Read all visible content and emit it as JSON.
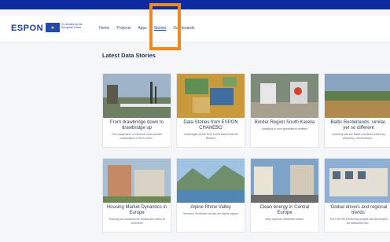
{
  "header": {
    "logo_text": "ESPON",
    "eu_text": "Co-funded by the European Union",
    "nav": [
      {
        "label": "Home"
      },
      {
        "label": "Projects"
      },
      {
        "label": "Apps"
      },
      {
        "label": "Stories"
      },
      {
        "label": "Dashboards"
      }
    ],
    "active_nav": "Stories"
  },
  "main": {
    "section_title": "Latest Data Stories",
    "cards": [
      {
        "title": "From drawbridge down to drawbridge up",
        "desc": "The suspension of external cross-border cooperation in EU's north..."
      },
      {
        "title": "Data Stories from ESPON CHANEBO",
        "desc": "Challenges at the EU's North-East External Borders"
      },
      {
        "title": "Border Region South Karelia",
        "desc": "Adapting to new geopolitical realities"
      },
      {
        "title": "Baltic Borderlands: similar, yet so different",
        "desc": "Zooming into the Baltic countries united by periphery, reinvented b..."
      },
      {
        "title": "Housing Market Dynamics in Europe",
        "desc": "Tracking ad durations for rentals and sales at local level"
      },
      {
        "title": "Alpine Rhine Valley",
        "desc": "Interface Territories across the Alpine region"
      },
      {
        "title": "Clean energy in Central Europe",
        "desc": "Why regional readiness matter"
      },
      {
        "title": "'Global drivers and regional trends'",
        "desc": "The ESPON ReGioSeq project has developed an interactive too..."
      }
    ]
  },
  "colors": {
    "background_outer": "#0d2aa0",
    "page": "#f5f6f8",
    "highlight": "#f08a1c",
    "brand": "#1d3aa8"
  }
}
